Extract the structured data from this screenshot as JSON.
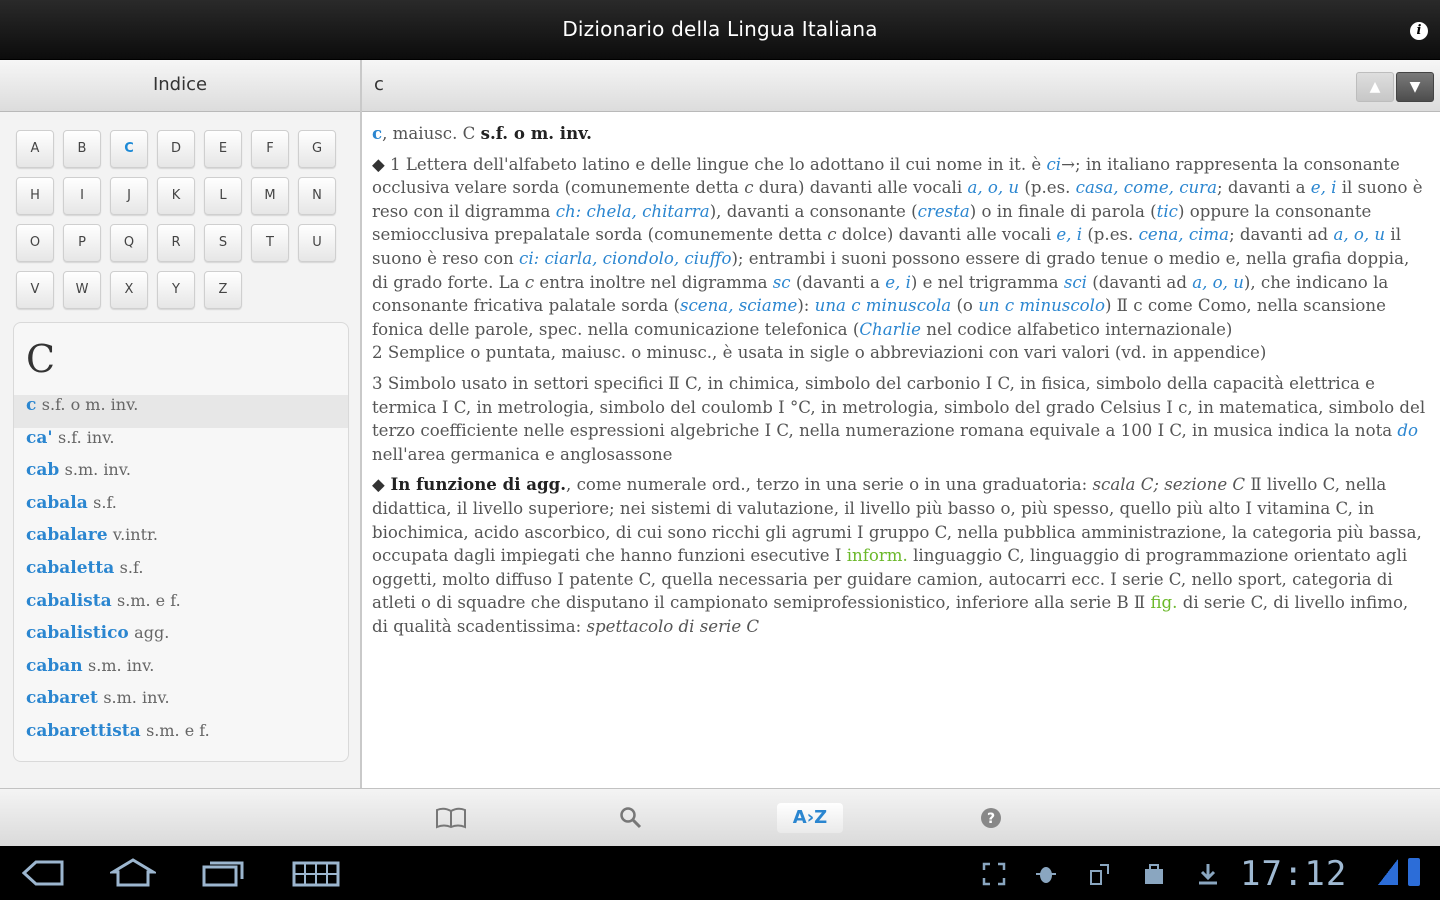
{
  "app": {
    "title": "Dizionario della Lingua Italiana"
  },
  "left": {
    "header": "Indice",
    "letters": [
      "A",
      "B",
      "C",
      "D",
      "E",
      "F",
      "G",
      "H",
      "I",
      "J",
      "K",
      "L",
      "M",
      "N",
      "O",
      "P",
      "Q",
      "R",
      "S",
      "T",
      "U",
      "V",
      "W",
      "X",
      "Y",
      "Z"
    ],
    "active_letter": "C",
    "big_letter": "C",
    "words": [
      {
        "hw": "c",
        "pos": "s.f. o m. inv."
      },
      {
        "hw": "ca'",
        "pos": "s.f. inv."
      },
      {
        "hw": "cab",
        "pos": "s.m. inv."
      },
      {
        "hw": "cabala",
        "pos": "s.f."
      },
      {
        "hw": "cabalare",
        "pos": "v.intr."
      },
      {
        "hw": "cabaletta",
        "pos": "s.f."
      },
      {
        "hw": "cabalista",
        "pos": "s.m. e f."
      },
      {
        "hw": "cabalistico",
        "pos": "agg."
      },
      {
        "hw": "caban",
        "pos": "s.m. inv."
      },
      {
        "hw": "cabaret",
        "pos": "s.m. inv."
      },
      {
        "hw": "cabarettista",
        "pos": "s.m. e f."
      }
    ]
  },
  "right": {
    "search_term": "c",
    "nav": {
      "up": "▲",
      "down": "▼"
    }
  },
  "entry": {
    "headword": "c",
    "head_rest": ", maiusc. C ",
    "head_pos": "s.f. o m. inv.",
    "p1": {
      "marker": "◆",
      "a": " 1 Lettera dell'alfabeto latino e delle lingue che lo adottano il cui nome in it. è ",
      "ci": "ci",
      "b": "→; in italiano rappresenta la consonante occlusiva velare sorda (comunemente detta ",
      "c1": "c",
      "c": " dura) davanti alle vocali ",
      "vocali1": "a, o, u",
      "d": " (p.es. ",
      "es1": "casa, come, cura",
      "e": "; davanti a ",
      "ei": "e, i",
      "f": " il suono è reso con il digramma ",
      "ch": "ch: chela, chitarra",
      "g": "), davanti a consonante (",
      "cresta": "cresta",
      "h": ") o in finale di parola (",
      "tic": "tic",
      "i": ") oppure la consonante semiocclusiva prepalatale sorda (comunemente detta ",
      "c2": "c",
      "j": " dolce) davanti alle vocali ",
      "ei2": "e, i",
      "k": " (p.es. ",
      "es2": "cena, cima",
      "l": "; davanti ad ",
      "aou2": "a, o, u",
      "m": " il suono è reso con ",
      "ci2": "ci: ciarla, ciondolo, ciuffo",
      "n": "); entrambi i suoni possono essere di grado tenue o medio e, nella grafia doppia, di grado forte. La ",
      "c3": "c",
      "o": " entra inoltre nel digramma ",
      "sc": "sc",
      "p": " (davanti a ",
      "ei3": "e, i",
      "q": ") e nel trigramma ",
      "sci": "sci",
      "r": " (davanti ad ",
      "aou3": "a, o, u",
      "s": "), che indicano la consonante fricativa palatale sorda (",
      "scena": "scena, sciame",
      "t": "): ",
      "una": "una c minuscola",
      "u": " (o ",
      "un": "un c minuscolo",
      "v": ") Ⅱ ",
      "como": "c come Como",
      "w": ", nella scansione fonica delle parole, spec. nella comunicazione telefonica (",
      "charlie": "Charlie",
      "x": " nel codice alfabetico internazionale)"
    },
    "p2": "2 Semplice o puntata, maiusc. o minusc., è usata in sigle o abbreviazioni con vari valori (vd. in appendice)",
    "p3": {
      "a": "3 Simbolo usato in settori specifici Ⅱ C, in chimica, simbolo del carbonio Ⅰ C, in fisica, simbolo della capacità elettrica e termica Ⅰ C, in metrologia, simbolo del coulomb Ⅰ °C, in metrologia, simbolo del grado Celsius Ⅰ c, in matematica, simbolo del terzo coefficiente nelle espressioni algebriche Ⅰ C, nella numerazione romana equivale a 100 Ⅰ C, in musica indica la nota ",
      "do": "do",
      "b": " nell'area germanica e anglosassone"
    },
    "p4": {
      "marker": "◆",
      "bold": " In funzione di agg.",
      "a": ", come numerale ord., terzo in una serie o in una graduatoria: ",
      "ex1": "scala C; sezione C",
      "b": " Ⅱ livello C, nella didattica, il livello superiore; nei sistemi di valutazione, il livello più basso o, più spesso, quello più alto Ⅰ vitamina C, in biochimica, acido ascorbico, di cui sono ricchi gli agrumi Ⅰ gruppo C, nella pubblica amministrazione, la categoria più bassa, occupata dagli impiegati che hanno funzioni esecutive Ⅰ ",
      "inform": "inform.",
      "c": " linguaggio C, linguaggio di programmazione orientato agli oggetti, molto diffuso Ⅰ patente C, quella necessaria per guidare camion, autocarri ecc. Ⅰ serie C, nello sport, categoria di atleti o di squadre che disputano il campionato semiprofessionistico, inferiore alla serie B Ⅱ ",
      "fig": "fig.",
      "d": " di serie C, di livello infimo, di qualità scadentissima: ",
      "ex2": "spettacolo di serie C"
    }
  },
  "toolbar": {
    "az_label": "A›Z"
  },
  "system": {
    "clock": "17:12",
    "colors": {
      "accent": "#2b86d0",
      "bar_blue": "#2c6dd8"
    }
  }
}
